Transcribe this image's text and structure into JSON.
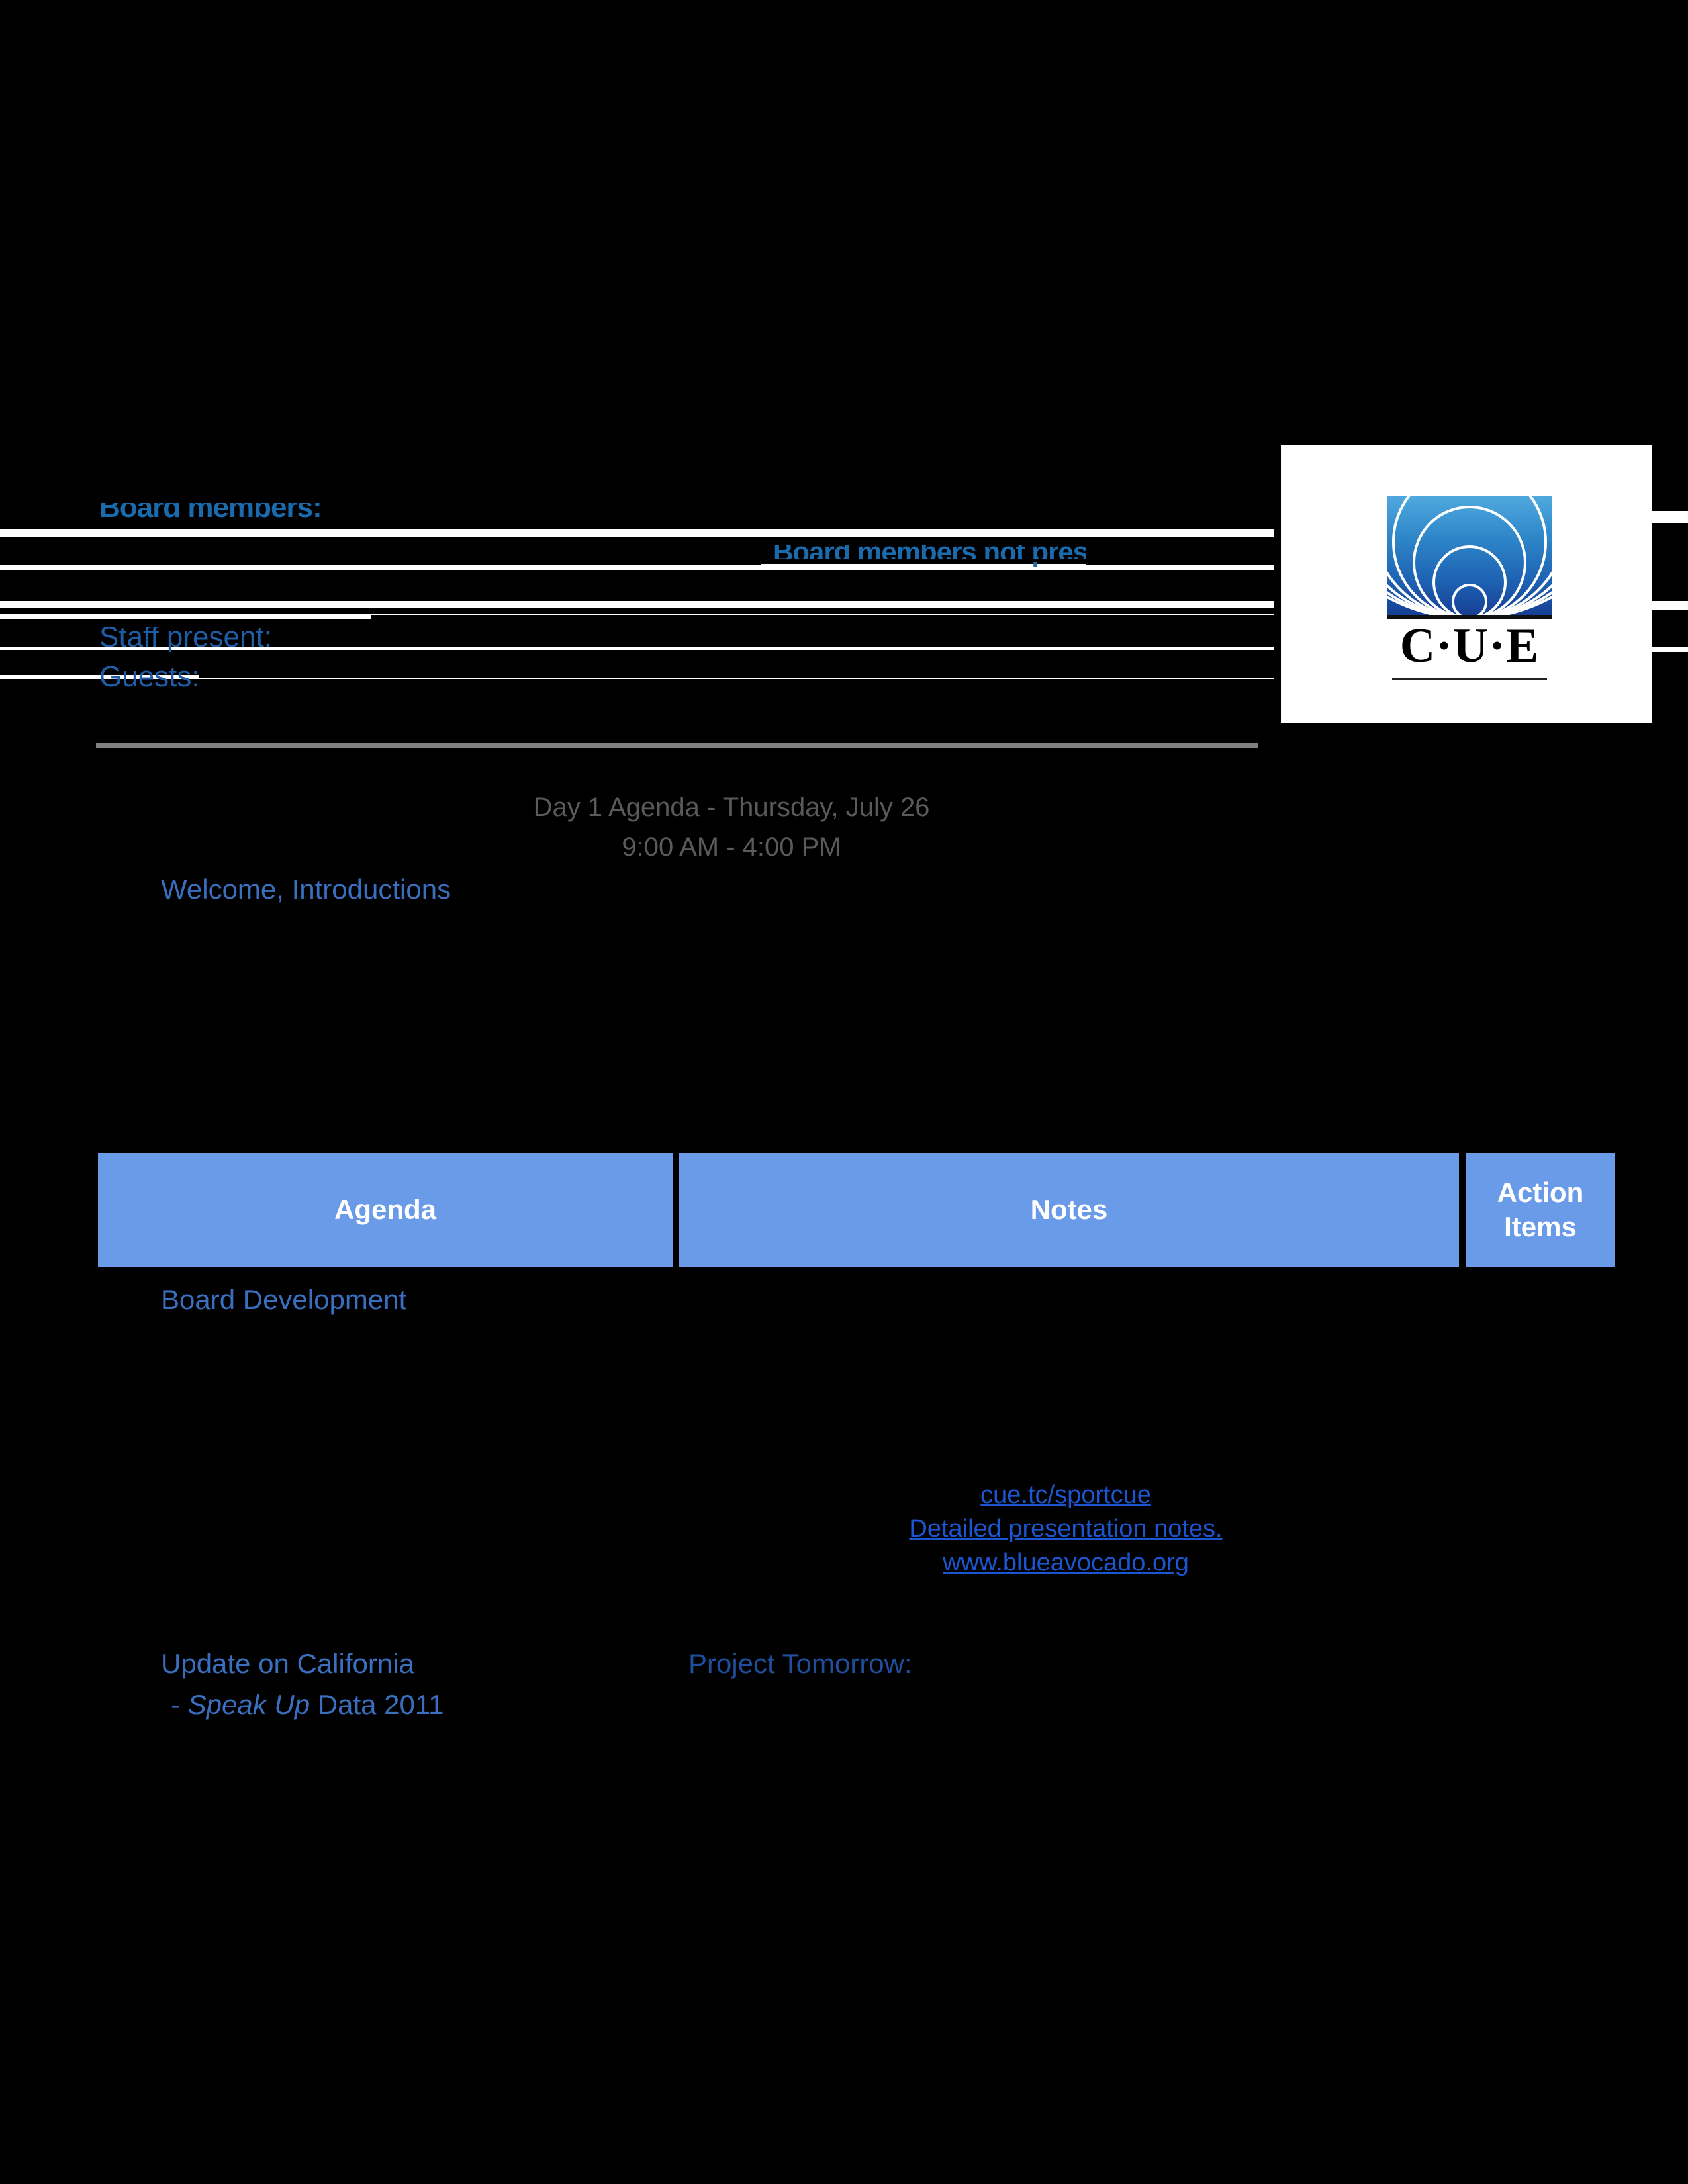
{
  "document": {
    "type": "board-meeting-agenda",
    "organization": "CUE"
  },
  "header": {
    "board_members_label": "Board members:",
    "board_members_not_present_label": "Board members not present:",
    "staff_present_label": "Staff present:",
    "guests_label": "Guests:"
  },
  "logo": {
    "wordmark": "C·U·E",
    "gradient_top": "#4FA9DE",
    "gradient_bottom": "#163F95",
    "arc_color": "#ffffff",
    "panel_background": "#ffffff"
  },
  "agenda_heading": {
    "line1": "Day 1 Agenda - Thursday, July 26",
    "line2": "9:00 AM - 4:00 PM",
    "color": "#5A5A5A"
  },
  "items": {
    "welcome": "Welcome, Introductions",
    "board_development": "Board Development",
    "update_on_california": "Update on California",
    "speak_up_italic": "Speak Up",
    "speak_up_prefix": "- ",
    "speak_up_suffix": " Data 2011",
    "project_tomorrow": "Project Tomorrow:"
  },
  "links": [
    {
      "label": "cue.tc/sportcue"
    },
    {
      "label": "Detailed presentation notes."
    },
    {
      "label": "www.blueavocado.org"
    }
  ],
  "table": {
    "columns": [
      {
        "label": "Agenda"
      },
      {
        "label": "Notes"
      },
      {
        "label": "Action Items"
      }
    ],
    "header_background": "#6A9BE8",
    "header_text_color": "#ffffff",
    "rows": []
  },
  "colors": {
    "page_background": "#000000",
    "redaction": "#000000",
    "header_blue": "#1A6BAE",
    "label_blue": "#1F5DA8",
    "item_blue": "#3A6FBF",
    "item_blue_dark": "#1F4E9C",
    "link_blue": "#1B55D0",
    "divider_gray": "#808080",
    "table_blue": "#6A9BE8"
  }
}
